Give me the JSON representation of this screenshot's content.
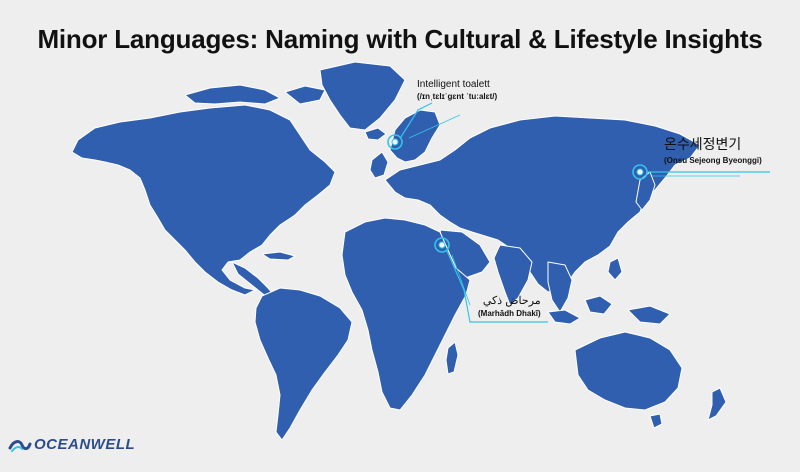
{
  "title": "Minor Languages: Naming with Cultural & Lifestyle Insights",
  "colors": {
    "land": "#2f5fae",
    "background": "#eeeeee",
    "callout": "#35c3ea",
    "brand": "#2d4d8a"
  },
  "callouts": [
    {
      "id": "se",
      "main": "Intelligent toalett",
      "sub": "(/ɪnˌtɛlɪˈɡɛnt ˈtuːalɛt/)"
    },
    {
      "id": "kr",
      "main": "온수세정변기",
      "sub": "(Onsu Sejeong Byeonggi)"
    },
    {
      "id": "ar",
      "main": "مرحاض ذكي",
      "sub": "(Marhādh Dhakī)"
    }
  ],
  "brand": {
    "name": "OCEANWELL",
    "icon": "wave-logo-icon"
  }
}
